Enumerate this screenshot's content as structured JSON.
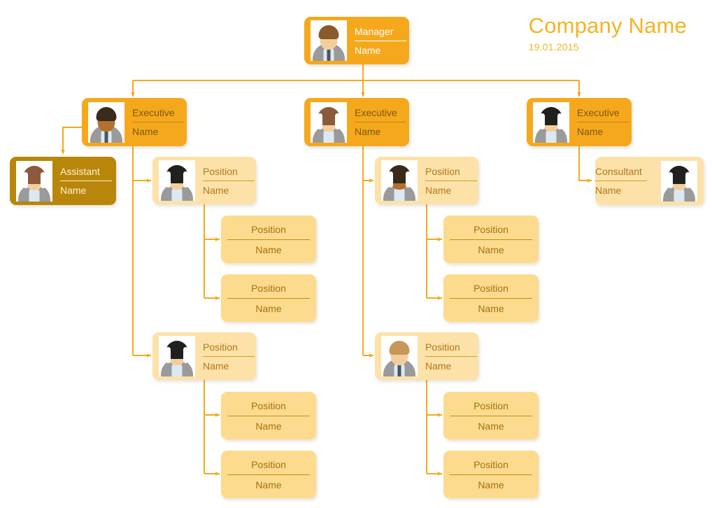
{
  "header": {
    "company_title": "Company Name",
    "date": "19.01.2015"
  },
  "theme": {
    "accent_orange": "#F6A81C",
    "title_orange": "#F5B323",
    "connector_orange": "#F5A91C",
    "assistant_brown": "#B8860B",
    "light_card": "#FCE2A8",
    "plain_card": "#FCDB8E",
    "background": "#FFFFFF"
  },
  "chart_data": {
    "type": "diagram",
    "diagram_kind": "organizational-chart",
    "title": "Company Name",
    "date": "19.01.2015",
    "levels": 4,
    "node_count": 18
  },
  "nodes": {
    "manager": {
      "role": "Manager",
      "name": "Name",
      "avatar": "male-brown-hair"
    },
    "exec_left": {
      "role": "Executive",
      "name": "Name",
      "avatar": "male-dark-skin"
    },
    "exec_mid": {
      "role": "Executive",
      "name": "Name",
      "avatar": "female-auburn-long"
    },
    "exec_right": {
      "role": "Executive",
      "name": "Name",
      "avatar": "female-black-bob"
    },
    "assistant": {
      "role": "Assistant",
      "name": "Name",
      "avatar": "female-auburn-long"
    },
    "consultant": {
      "role": "Consultant",
      "name": "Name",
      "avatar": "female-black-bob"
    },
    "l1_pos_a": {
      "role": "Position",
      "name": "Name",
      "avatar": "female-black-bob"
    },
    "l1_pos_b": {
      "role": "Position",
      "name": "Name",
      "avatar": "female-black-bob"
    },
    "m1_pos_a": {
      "role": "Position",
      "name": "Name",
      "avatar": "female-dark-skin"
    },
    "m1_pos_b": {
      "role": "Position",
      "name": "Name",
      "avatar": "male-blond"
    },
    "l1_leaf_1": {
      "role": "Position",
      "name": "Name"
    },
    "l1_leaf_2": {
      "role": "Position",
      "name": "Name"
    },
    "l2_leaf_1": {
      "role": "Position",
      "name": "Name"
    },
    "l2_leaf_2": {
      "role": "Position",
      "name": "Name"
    },
    "m1_leaf_1": {
      "role": "Position",
      "name": "Name"
    },
    "m1_leaf_2": {
      "role": "Position",
      "name": "Name"
    },
    "m2_leaf_1": {
      "role": "Position",
      "name": "Name"
    },
    "m2_leaf_2": {
      "role": "Position",
      "name": "Name"
    }
  }
}
